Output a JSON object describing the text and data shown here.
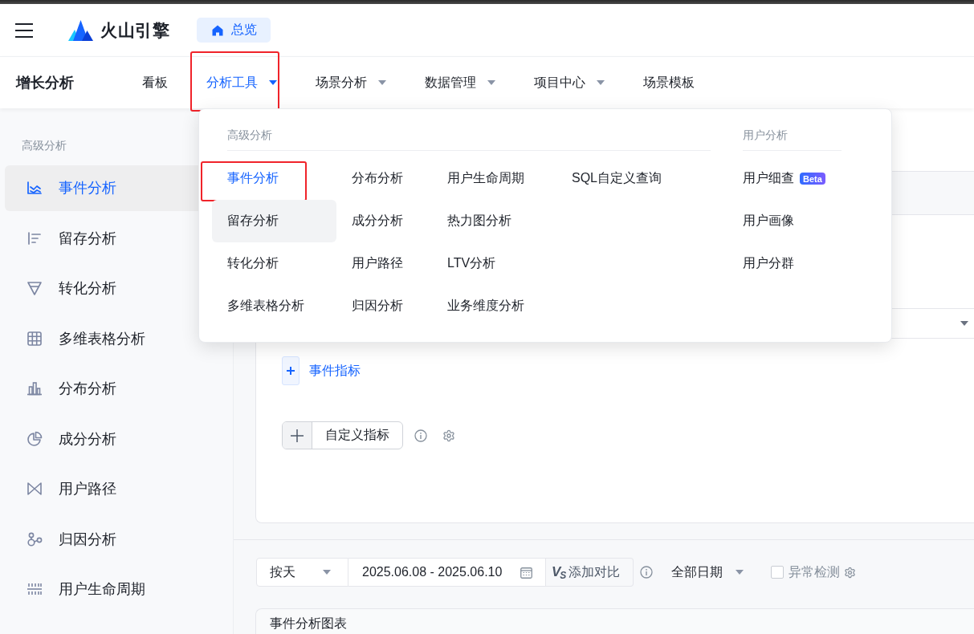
{
  "header": {
    "logo_text": "火山引擎",
    "home_button": "总览"
  },
  "nav": {
    "title": "增长分析",
    "tabs": [
      {
        "label": "看板",
        "selected": false,
        "has_menu": false,
        "highlighted": false
      },
      {
        "label": "分析工具",
        "selected": true,
        "has_menu": true,
        "highlighted": true
      },
      {
        "label": "场景分析",
        "selected": false,
        "has_menu": true,
        "highlighted": false
      },
      {
        "label": "数据管理",
        "selected": false,
        "has_menu": true,
        "highlighted": false
      },
      {
        "label": "项目中心",
        "selected": false,
        "has_menu": true,
        "highlighted": false
      },
      {
        "label": "场景模板",
        "selected": false,
        "has_menu": false,
        "highlighted": false
      }
    ]
  },
  "sidebar": {
    "group_label": "高级分析",
    "items": [
      {
        "label": "事件分析",
        "selected": true
      },
      {
        "label": "留存分析",
        "selected": false
      },
      {
        "label": "转化分析",
        "selected": false
      },
      {
        "label": "多维表格分析",
        "selected": false
      },
      {
        "label": "分布分析",
        "selected": false
      },
      {
        "label": "成分分析",
        "selected": false
      },
      {
        "label": "用户路径",
        "selected": false
      },
      {
        "label": "归因分析",
        "selected": false
      },
      {
        "label": "用户生命周期",
        "selected": false
      }
    ]
  },
  "dropdown": {
    "sections": [
      {
        "title": "高级分析",
        "columns": [
          [
            {
              "label": "事件分析",
              "selected": true,
              "hovered": false,
              "highlighted": true
            },
            {
              "label": "留存分析",
              "selected": false,
              "hovered": true,
              "highlighted": false
            },
            {
              "label": "转化分析",
              "selected": false,
              "hovered": false,
              "highlighted": false
            },
            {
              "label": "多维表格分析",
              "selected": false,
              "hovered": false,
              "highlighted": false
            }
          ],
          [
            {
              "label": "分布分析",
              "selected": false,
              "hovered": false,
              "highlighted": false
            },
            {
              "label": "成分分析",
              "selected": false,
              "hovered": false,
              "highlighted": false
            },
            {
              "label": "用户路径",
              "selected": false,
              "hovered": false,
              "highlighted": false
            },
            {
              "label": "归因分析",
              "selected": false,
              "hovered": false,
              "highlighted": false
            }
          ],
          [
            {
              "label": "用户生命周期",
              "selected": false,
              "hovered": false,
              "highlighted": false
            },
            {
              "label": "热力图分析",
              "selected": false,
              "hovered": false,
              "highlighted": false
            },
            {
              "label": "LTV分析",
              "selected": false,
              "hovered": false,
              "highlighted": false
            },
            {
              "label": "业务维度分析",
              "selected": false,
              "hovered": false,
              "highlighted": false
            }
          ],
          [
            {
              "label": "SQL自定义查询",
              "selected": false,
              "hovered": false,
              "highlighted": false
            }
          ]
        ]
      },
      {
        "title": "用户分析",
        "columns": [
          [
            {
              "label": "用户细查",
              "badge": "Beta",
              "selected": false,
              "hovered": false,
              "highlighted": false
            },
            {
              "label": "用户画像",
              "selected": false,
              "hovered": false,
              "highlighted": false
            },
            {
              "label": "用户分群",
              "selected": false,
              "hovered": false,
              "highlighted": false
            }
          ]
        ]
      }
    ]
  },
  "event_panel": {
    "event_metric_button": "事件指标",
    "custom_metric_button": "自定义指标"
  },
  "toolbar": {
    "granularity": "按天",
    "date_range": "2025.06.08 - 2025.06.10",
    "compare_glyph": "V$_{S}$",
    "compare_button": "添加对比",
    "date_filter": "全部日期",
    "anomaly_detection": {
      "label": "异常检测",
      "checked": false
    }
  },
  "chart_card": {
    "title": "事件分析图表"
  }
}
